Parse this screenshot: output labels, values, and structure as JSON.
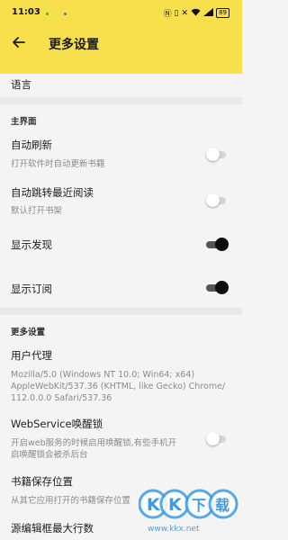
{
  "status_bar": {
    "time": "11:03",
    "icons": [
      "nfc-icon",
      "vibrate-icon",
      "mute-icon",
      "wifi-icon",
      "signal-icon"
    ],
    "battery": "89"
  },
  "toolbar": {
    "title": "更多设置"
  },
  "items": {
    "language": {
      "title": "语言"
    },
    "section_main": "主界面",
    "auto_refresh": {
      "title": "自动刷新",
      "sub": "打开软件时自动更新书籍",
      "on": false
    },
    "auto_jump": {
      "title": "自动跳转最近阅读",
      "sub": "默认打开书架",
      "on": false
    },
    "show_discover": {
      "title": "显示发现",
      "on": true
    },
    "show_subscribe": {
      "title": "显示订阅",
      "on": true
    },
    "section_more": "更多设置",
    "user_agent": {
      "title": "用户代理",
      "sub_line1": "Mozilla/5.0 (Windows NT 10.0; Win64; x64)",
      "sub_line2": "AppleWebKit/537.36 (KHTML, like Gecko) Chrome/",
      "sub_line3": "112.0.0.0 Safari/537.36"
    },
    "webservice": {
      "title": "WebService唤醒锁",
      "sub_line1": "开启web服务的时候启用唤醒锁,有些手机开",
      "sub_line2": "启唤醒锁会被杀后台",
      "on": false
    },
    "book_storage": {
      "title": "书籍保存位置",
      "sub": "从其它应用打开的书籍保存位置"
    },
    "source_editor": {
      "title": "源编辑框最大行数"
    }
  },
  "watermark": {
    "text": "KK下载",
    "url_text": "www.kkx.net"
  },
  "colors": {
    "header": "#f8e04d",
    "background": "#f4f4f4",
    "switch_on": "#0d0d0d"
  }
}
